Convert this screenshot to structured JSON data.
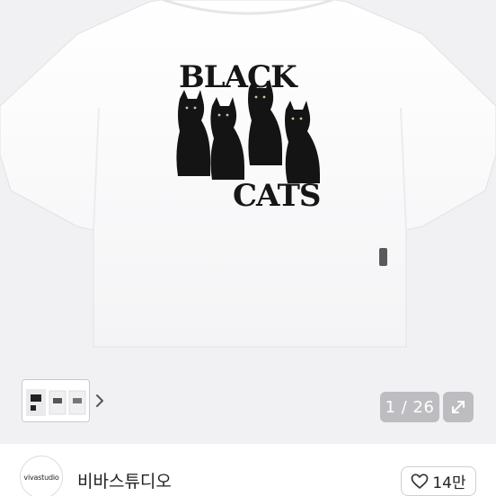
{
  "product": {
    "print_line1": "BLACK",
    "print_line2": "CATS"
  },
  "gallery": {
    "page_counter": "1 / 26",
    "thumbnail_count_shown": 1
  },
  "icons": {
    "next": "chevron-right-icon",
    "expand": "expand-arrows-icon",
    "like": "heart-outline-icon"
  },
  "seller": {
    "avatar_text": "vivastudio",
    "name": "비바스튜디오"
  },
  "likes": {
    "count_label": "14만"
  }
}
